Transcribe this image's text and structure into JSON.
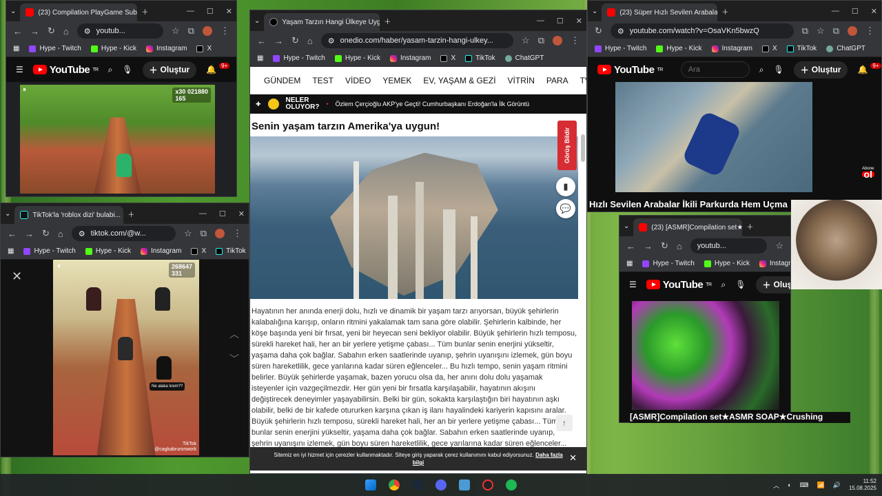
{
  "window_controls": {
    "minimize": "—",
    "maximize": "☐",
    "close": "✕"
  },
  "bookmarks": {
    "twitch": "Hype - Twitch",
    "kick": "Hype - Kick",
    "instagram": "Instagram",
    "x": "X",
    "tiktok": "TikTok",
    "chatgpt": "ChatGPT"
  },
  "youtube": {
    "logo": "YouTube",
    "tr": "TR",
    "create": "Oluştur",
    "search_placeholder": "Ara",
    "notif_count": "9+"
  },
  "win_topleft": {
    "tab_title": "(23) Compilation PlayGame Sub...",
    "url": "youtub...",
    "game_score": "021880",
    "game_coins": "165",
    "game_multiplier": "x30"
  },
  "win_tiktok": {
    "tab_title": "TikTok'la 'roblox dizi' bulabi...",
    "url": "tiktok.com/@w...",
    "game_score": "268647",
    "game_coins": "331",
    "caption_text": "Ne alaka lırem??",
    "watermark": "TikTok",
    "watermark_user": "@cagkabruronwork"
  },
  "win_article": {
    "tab_title": "Yaşam Tarzın Hangi Ülkeye Uyg...",
    "url": "onedio.com/haber/yasam-tarzin-hangi-ulkey...",
    "nav": [
      "GÜNDEM",
      "TEST",
      "VİDEO",
      "YEMEK",
      "EV, YAŞAM & GEZİ",
      "VİTRİN",
      "PARA",
      "TV & SİN"
    ],
    "ticker_label_1": "NELER",
    "ticker_label_2": "OLUYOR?",
    "ticker_text": "Özlem Çerçioğlu AKP'ye Geçti! Cumhurbaşkanı Erdoğan'la İlk Görüntü",
    "headline": "Senin yaşam tarzın Amerika'ya uygun!",
    "gorus_button": "Görüş Bildir",
    "body": "Hayatının her anında enerji dolu, hızlı ve dinamik bir yaşam tarzı arıyorsan, büyük şehirlerin kalabalığına karışıp, onların ritmini yakalamak tam sana göre olabilir. Şehirlerin kalbinde, her köşe başında yeni bir fırsat, yeni bir heyecan seni bekliyor olabilir. Büyük şehirlerin hızlı temposu, sürekli hareket hali, her an bir yerlere yetişme çabası... Tüm bunlar senin enerjini yükseltir, yaşama daha çok bağlar. Sabahın erken saatlerinde uyanıp, şehrin uyanışını izlemek, gün boyu süren hareketlilik, gece yarılarına kadar süren eğlenceler... Bu hızlı tempo, senin yaşam ritmini belirler. Büyük şehirlerde yaşamak, bazen yorucu olsa da, her anını dolu dolu yaşamak isteyenler için vazgeçilmezdir. Her gün yeni bir fırsatla karşılaşabilir, hayatının akışını değiştirecek deneyimler yaşayabilirsin. Belki bir gün, sokakta karşılaştığın biri hayatının aşkı olabilir, belki de bir kafede otururken karşına çıkan iş ilanı hayalindeki kariyerin kapısını aralar. Büyük şehirlerin hızlı temposu, sürekli hareket hali, her an bir yerlere yetişme çabası... Tüm bunlar senin enerjini yükseltir, yaşama daha çok bağlar. Sabahın erken saatlerinde uyanıp, şehrin uyanışını izlemek, gün boyu süren hareketlilik, gece yarılarına kadar süren eğlenceler... Bu hızlı tempo, senin yaşam ritmini belirler. Bu hızlı ve dinamik yaşam tarzı, senin hayatını renklendirir, daha da mutlu eder. Bu hızlı ve dinamik yaşam tarzı, senin hayatını renklendirir, daha da",
    "cookie_text": "Sitemiz en iyi hizmet için çerezler kullanmaktadır. Siteye giriş yaparak çerez kullanımını kabul ediyorsunuz.",
    "cookie_link": "Daha fazla bilgi",
    "cookie_close": "✕",
    "scroll_top": "↑"
  },
  "win_topright": {
    "tab_title": "(23) Süper Hızlı Sevilen Arabalar...",
    "url": "youtube.com/watch?v=OsaVKn5bwzQ",
    "video_title": "Hızlı Sevilen Arabalar İkili Parkurda Hem Uçma H",
    "channel_badge": "ol",
    "channel_badge_small": "Abone"
  },
  "win_asmr": {
    "tab_title": "(23) [ASMR]Compilation set★A...",
    "url": "youtub...",
    "video_title": "[ASMR]Compilation set★ASMR SOAP★Crushing"
  },
  "taskbar": {
    "clock_time": "11:52",
    "clock_date": "15.08.2025"
  },
  "colors": {
    "accent": "#ff0000",
    "onedio_red": "#d62d34",
    "taskbar": "#202226"
  }
}
